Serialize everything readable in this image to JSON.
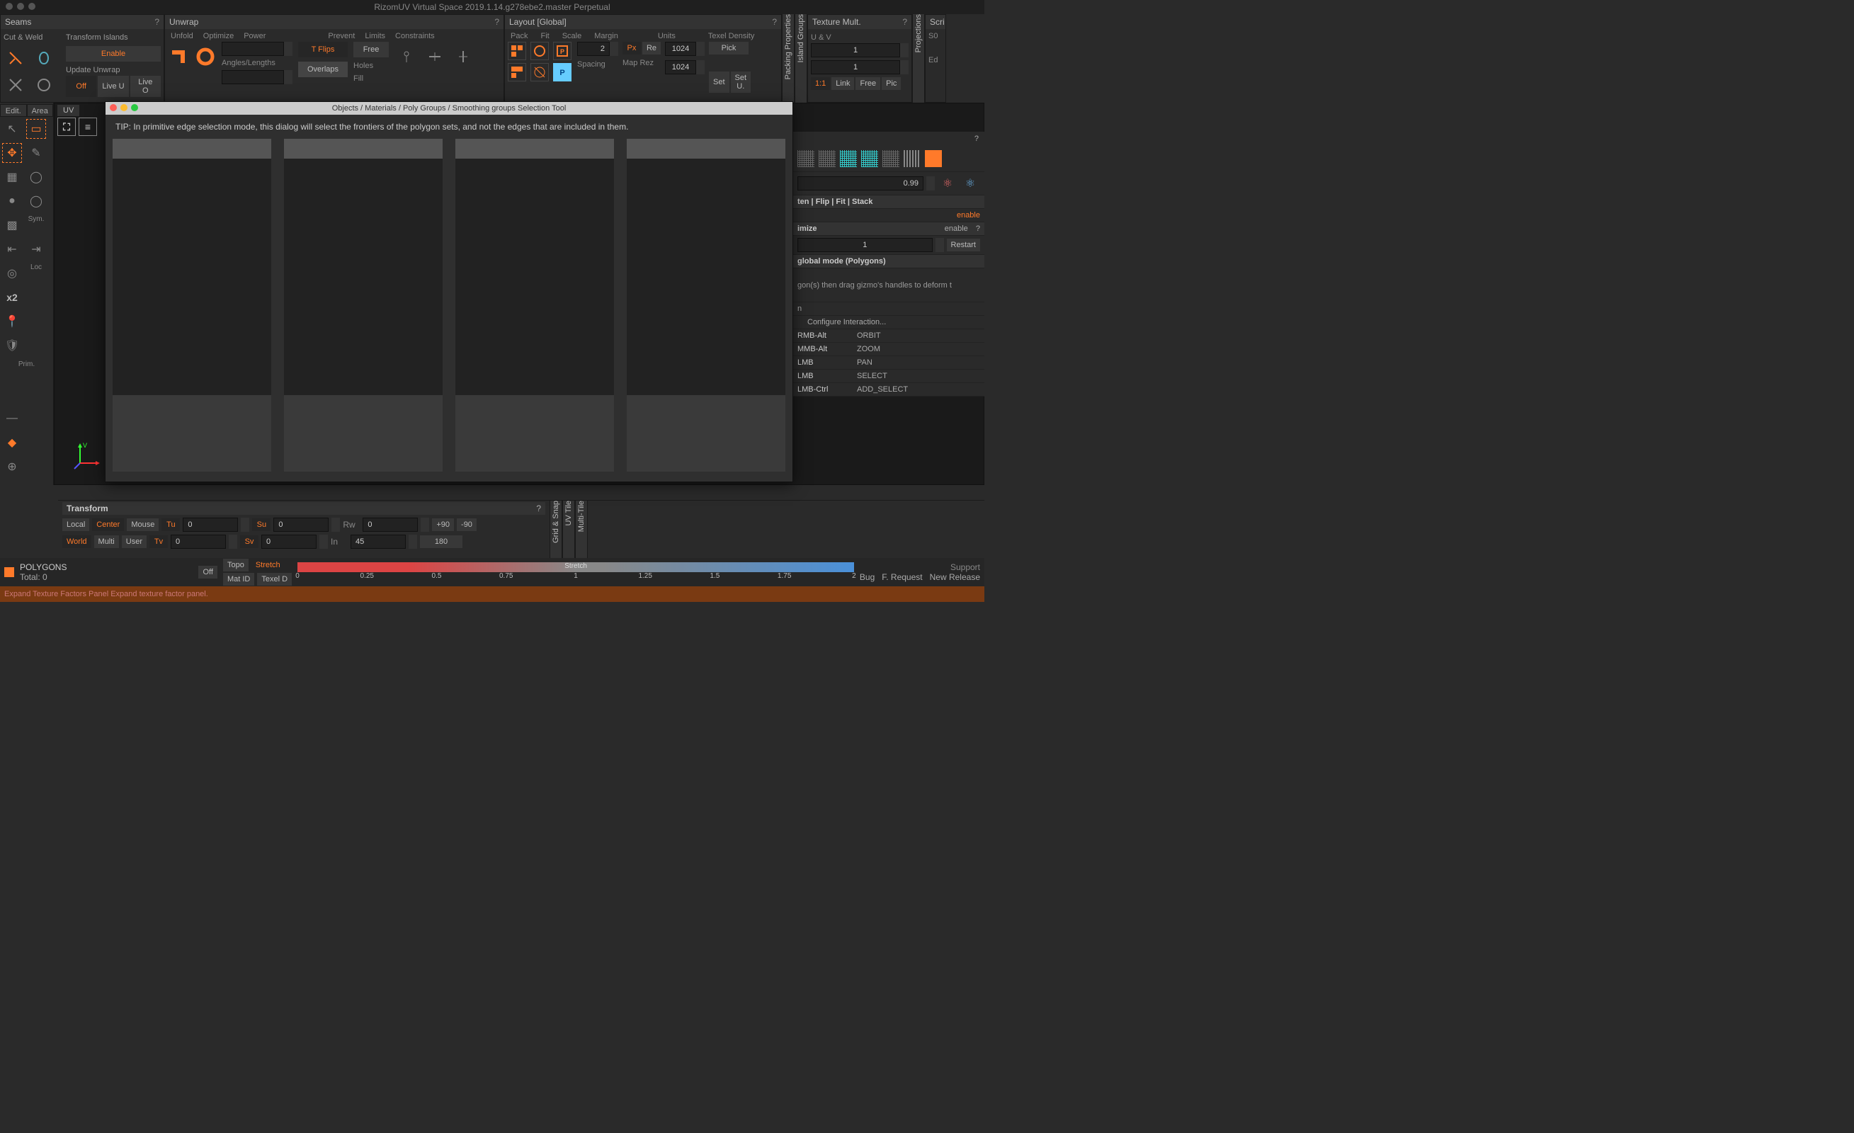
{
  "app_title": "RizomUV  Virtual Space  2019.1.14.g278ebe2.master Perpetual",
  "seams": {
    "title": "Seams",
    "help": "?",
    "cut_weld": "Cut & Weld",
    "transform_islands": "Transform Islands",
    "enable": "Enable",
    "update_unwrap": "Update Unwrap",
    "off": "Off",
    "live_u": "Live U",
    "live_o": "Live O"
  },
  "unwrap": {
    "title": "Unwrap",
    "help": "?",
    "cols": [
      "Unfold",
      "Optimize",
      "Power",
      "",
      "Prevent",
      "Limits",
      "Constraints"
    ],
    "tflips": "T Flips",
    "free": "Free",
    "angles": "Angles/Lengths",
    "overlaps": "Overlaps",
    "holes": "Holes",
    "fill": "Fill"
  },
  "layout": {
    "title": "Layout [Global]",
    "help": "?",
    "cols": [
      "Pack",
      "Fit",
      "Scale",
      "Margin",
      "",
      "Units",
      "",
      "Texel Density"
    ],
    "margin": "2",
    "px": "Px",
    "re": "Re",
    "spacing": "Spacing",
    "maprez": "Map Rez",
    "v1024": "1024",
    "v1024b": "1024",
    "pick": "Pick",
    "set": "Set",
    "setu": "Set U."
  },
  "pack_props": "Packing Properties",
  "island_groups": "Island Groups",
  "texmult": {
    "title": "Texture Mult.",
    "help": "?",
    "uv": "U & V",
    "v1": "1",
    "v1b": "1",
    "oneone": "1:1",
    "link": "Link",
    "free": "Free",
    "pic": "Pic"
  },
  "projections": "Projections",
  "scri": {
    "title": "Scri",
    "s0": "S0",
    "ed": "Ed"
  },
  "dialog": {
    "title": "Objects / Materials / Poly Groups / Smoothing groups Selection Tool",
    "tip": "TIP: In primitive edge selection mode, this dialog will select the frontiers of the polygon sets, and not the edges that are included in them."
  },
  "left": {
    "edit": "Edit.",
    "area": "Area",
    "uv": "UV",
    "sym": "Sym.",
    "loc": "Loc",
    "prim": "Prim.",
    "x2": "x2",
    "axis_v": "V"
  },
  "transform": {
    "title": "Transform",
    "help": "?",
    "local": "Local",
    "center": "Center",
    "mouse": "Mouse",
    "world": "World",
    "multi": "Multi",
    "user": "User",
    "tu": "Tu",
    "tv": "Tv",
    "su": "Su",
    "sv": "Sv",
    "rw": "Rw",
    "inlab": "In",
    "tu_v": "0",
    "tv_v": "0",
    "su_v": "0",
    "sv_v": "0",
    "rw_v": "0",
    "in_v": "45",
    "p90": "+90",
    "m90": "-90",
    "r180": "180"
  },
  "transform_tabs": {
    "grid": "Grid & Snap",
    "uvtile": "UV Tile",
    "multitile": "Multi-Tile"
  },
  "right": {
    "val099": "0.99",
    "flf": "ten | Flip | Fit | Stack",
    "enable": "enable",
    "imize": "imize",
    "enable2": "enable",
    "q": "?",
    "one": "1",
    "restart": "Restart",
    "global": "global mode (Polygons)",
    "tip": "gon(s) then drag gizmo's handles to deform t",
    "n": "n",
    "configure": "Configure Interaction..."
  },
  "bindings": [
    {
      "k": "RMB-Alt",
      "v": "ORBIT"
    },
    {
      "k": "MMB-Alt",
      "v": "ZOOM"
    },
    {
      "k": "LMB",
      "v": "PAN"
    },
    {
      "k": "LMB",
      "v": "SELECT"
    },
    {
      "k": "LMB-Ctrl",
      "v": "ADD_SELECT"
    }
  ],
  "status": {
    "polygons": "POLYGONS",
    "total": "Total: 0",
    "off": "Off",
    "topo": "Topo",
    "stretch": "Stretch",
    "matid": "Mat ID",
    "texeld": "Texel D",
    "stretch_lbl": "Stretch",
    "ticks": [
      "0",
      "0.25",
      "0.5",
      "0.75",
      "1",
      "1.25",
      "1.5",
      "1.75",
      "2"
    ],
    "support": "Support",
    "bug": "Bug",
    "freq": "F. Request",
    "newrel": "New Release"
  },
  "tooltip": "Expand Texture Factors Panel  Expand texture factor panel."
}
